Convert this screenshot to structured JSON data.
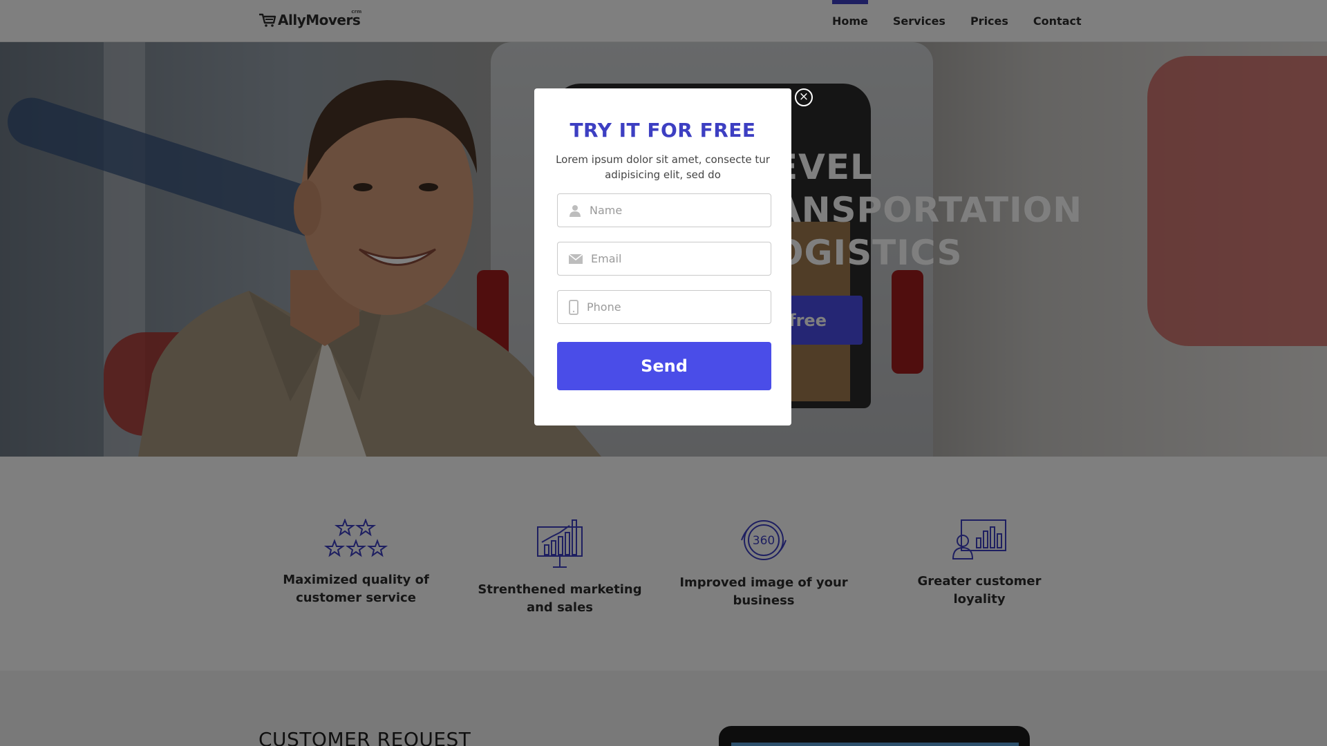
{
  "header": {
    "logo_text": "AllyMovers",
    "logo_tag": "crm",
    "nav": [
      {
        "label": "Home",
        "active": true
      },
      {
        "label": "Services",
        "active": false
      },
      {
        "label": "Prices",
        "active": false
      },
      {
        "label": "Contact",
        "active": false
      }
    ]
  },
  "hero": {
    "heading_lines": [
      "EVEL",
      "ANSPORTATION",
      "OGISTICS"
    ],
    "button_label": "free"
  },
  "features": [
    {
      "icon": "stars-icon",
      "label": "Maximized quality of customer service"
    },
    {
      "icon": "chart-board-icon",
      "label": "Strenthened marketing and sales"
    },
    {
      "icon": "360-icon",
      "label": "Improved image of your business"
    },
    {
      "icon": "customer-chart-icon",
      "label": "Greater customer loyality"
    }
  ],
  "request": {
    "title": "CUSTOMER REQUEST"
  },
  "modal": {
    "title": "TRY IT FOR FREE",
    "subtitle": "Lorem ipsum dolor sit amet, consecte tur adipisicing elit, sed do",
    "fields": {
      "name_placeholder": "Name",
      "email_placeholder": "Email",
      "phone_placeholder": "Phone"
    },
    "send_label": "Send",
    "close_symbol": "×"
  },
  "colors": {
    "accent": "#4a4de8",
    "title_blue": "#3d3fc2",
    "overlay": "rgba(0,0,0,0.5)"
  }
}
